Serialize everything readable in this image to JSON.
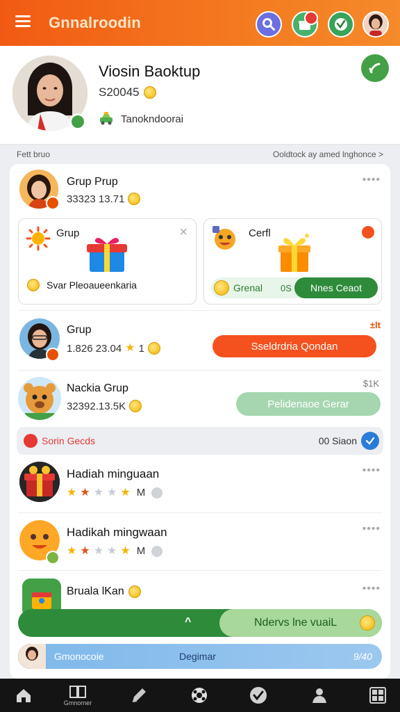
{
  "header": {
    "title": "Gnnalroodin",
    "icons": [
      "search-icon",
      "gift-icon",
      "check-icon",
      "avatar"
    ]
  },
  "profile": {
    "name": "Viosin Baoktup",
    "id": "S20045",
    "location": "Tanokndoorai"
  },
  "section": {
    "left": "Fett bruo",
    "right": "Ooldtock ay amed lnghonce >"
  },
  "rows": {
    "group1": {
      "title": "Grup Prup",
      "sub": "33323 13.71"
    },
    "gift_left": {
      "title": "Grup",
      "label": "Svar Pleoaueenkaria"
    },
    "gift_right": {
      "title": "Cerfl",
      "chip": "Grenal",
      "tag": "0S",
      "button": "Nnes Ceaot"
    },
    "group2": {
      "title": "Grup",
      "sub": "1.826 23.04",
      "count": "1",
      "corner": "±lt",
      "button": "Sseldrdria Qondan"
    },
    "group3": {
      "title": "Nackia Grup",
      "sub": "32392.13.5K",
      "corner": "$1K",
      "button": "Pelidenaoe Gerar"
    },
    "search_bar": {
      "left": "Sorin Gecds",
      "right": "00 Siaon"
    },
    "reward1": {
      "title": "Hadiah minguaan",
      "suffix": "M"
    },
    "reward2": {
      "title": "Hadikah mingwaan",
      "suffix": "M"
    },
    "reward3": {
      "title": "Bruala lKan",
      "button_left": "^",
      "button_right": "Ndervs lne vuaiL"
    },
    "bottom_bar": {
      "left": "Gmonocoie",
      "center": "Degimar",
      "right": "9/40"
    }
  },
  "nav": {
    "items": [
      {
        "icon": "home-icon",
        "label": ""
      },
      {
        "icon": "book-icon",
        "label": "Gmnorner"
      },
      {
        "icon": "pencil-icon",
        "label": ""
      },
      {
        "icon": "ball-icon",
        "label": ""
      },
      {
        "icon": "check-circle-icon",
        "label": ""
      },
      {
        "icon": "person-icon",
        "label": ""
      },
      {
        "icon": "grid-icon",
        "label": ""
      }
    ]
  },
  "colors": {
    "accent": "#f26a1b",
    "green": "#43a047",
    "blue": "#2b7bd8"
  }
}
